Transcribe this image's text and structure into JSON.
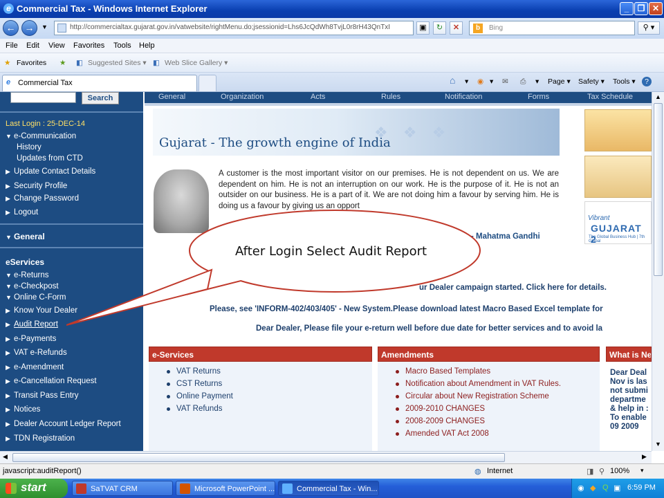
{
  "window": {
    "title": "Commercial Tax - Windows Internet Explorer"
  },
  "address": {
    "url": "http://commercialtax.gujarat.gov.in/vatwebsite/rightMenu.do;jsessionid=Lhs6JcQdWh8TvjL0r8rH43QnTxI",
    "search_placeholder": "Bing"
  },
  "menu": [
    "File",
    "Edit",
    "View",
    "Favorites",
    "Tools",
    "Help"
  ],
  "favorites": {
    "label": "Favorites",
    "suggested": "Suggested Sites ▾",
    "webslice": "Web Slice Gallery ▾"
  },
  "tab": {
    "title": "Commercial Tax"
  },
  "toolbar": {
    "page": "Page ▾",
    "safety": "Safety ▾",
    "tools": "Tools ▾"
  },
  "sidebar": {
    "search_button": "Search",
    "last_login": "Last Login : 25-DEC-14",
    "items": [
      "e-Communication",
      "History",
      "Updates from CTD",
      "Update Contact Details",
      "Security Profile",
      "Change Password",
      "Logout"
    ],
    "general_header": "General",
    "eservices_header": "eServices",
    "eservices_items": [
      "e-Returns",
      "e-Checkpost",
      "Online C-Form",
      "Know Your Dealer",
      "Audit Report",
      "e-Payments",
      "VAT e-Refunds",
      "e-Amendment",
      "e-Cancellation Request",
      "Transit Pass Entry",
      "Notices",
      "Dealer Account Ledger Report",
      "TDN Registration"
    ]
  },
  "topnav": [
    "General",
    "Organization",
    "Acts",
    "Rules",
    "Notification",
    "Forms",
    "Tax Schedule"
  ],
  "banner": {
    "title": "Gujarat - The growth engine of India"
  },
  "quote": {
    "text": "A customer is the most important visitor on our premises. He is not dependent on us. We are dependent on him. He is not an interruption on our work. He is the purpose of it. He is not an outsider on our business. He is a part of it. We are not doing him a favour by serving him. He is doing us a favour by giving us an opport",
    "author": "- Mahatma Gandhi"
  },
  "vibrant": {
    "word1": "Vibrant",
    "word2": "GUJARAT 2",
    "tagline": "The Global Business Hub | 7th Global"
  },
  "notices": {
    "campaign": "ur Dealer campaign started. Click here for details.",
    "inform": "Please, see 'INFORM-402/403/405' - New System.Please download latest Macro Based Excel template for",
    "ereturn": "Dear Dealer, Please file your e-return well before due date for better services and to avoid la"
  },
  "panels": {
    "eservices": {
      "title": "e-Services",
      "items": [
        "VAT Returns",
        "CST Returns",
        "Online Payment",
        "VAT Refunds"
      ]
    },
    "amendments": {
      "title": "Amendments",
      "items": [
        "Macro Based Templates",
        "Notification about Amendment in VAT Rules.",
        "Circular about New Registration Scheme",
        "2009-2010 CHANGES",
        "2008-2009 CHANGES",
        "Amended VAT Act 2008"
      ]
    },
    "whatsnew": {
      "title": "What is Ne",
      "text": "Dear Deal Nov is las not submi departme & help in : To enable 09 2009"
    }
  },
  "callout": {
    "text": "After Login Select Audit Report"
  },
  "status": {
    "left": "javascript:auditReport()",
    "zone": "Internet",
    "zoom": "100%"
  },
  "taskbar": {
    "start": "start",
    "tasks": [
      "SaTVAT CRM",
      "Microsoft PowerPoint ...",
      "Commercial Tax - Win..."
    ],
    "clock": "6:59 PM"
  }
}
